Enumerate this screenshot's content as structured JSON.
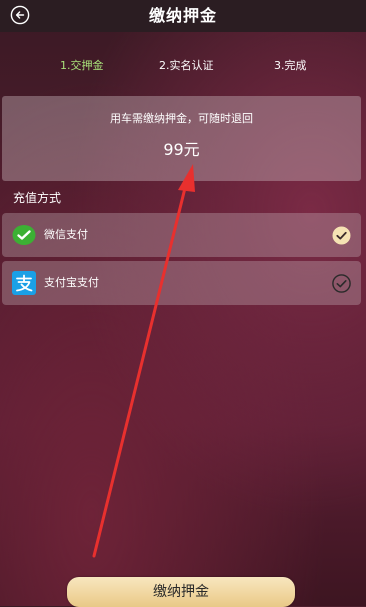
{
  "header": {
    "title": "缴纳押金",
    "back_icon": "back-arrow-icon"
  },
  "steps": [
    {
      "label": "1.交押金",
      "active": true
    },
    {
      "label": "2.实名认证",
      "active": false
    },
    {
      "label": "3.完成",
      "active": false
    }
  ],
  "deposit": {
    "note": "用车需缴纳押金，可随时退回",
    "amount": "99元"
  },
  "payment": {
    "section_label": "充值方式",
    "options": [
      {
        "label": "微信支付",
        "icon": "wechat-pay-icon",
        "selected": true
      },
      {
        "label": "支付宝支付",
        "icon": "alipay-icon",
        "selected": false
      }
    ]
  },
  "footer": {
    "button_label": "缴纳押金"
  },
  "colors": {
    "header_bg": "#2b1d22",
    "active_step": "#a8e07a",
    "wechat_green": "#3cb034",
    "alipay_blue": "#1aa0e6",
    "check_selected_fill": "#f5e2b3",
    "button_gold": "#f0d59d",
    "annotation_red": "#e8302e"
  }
}
